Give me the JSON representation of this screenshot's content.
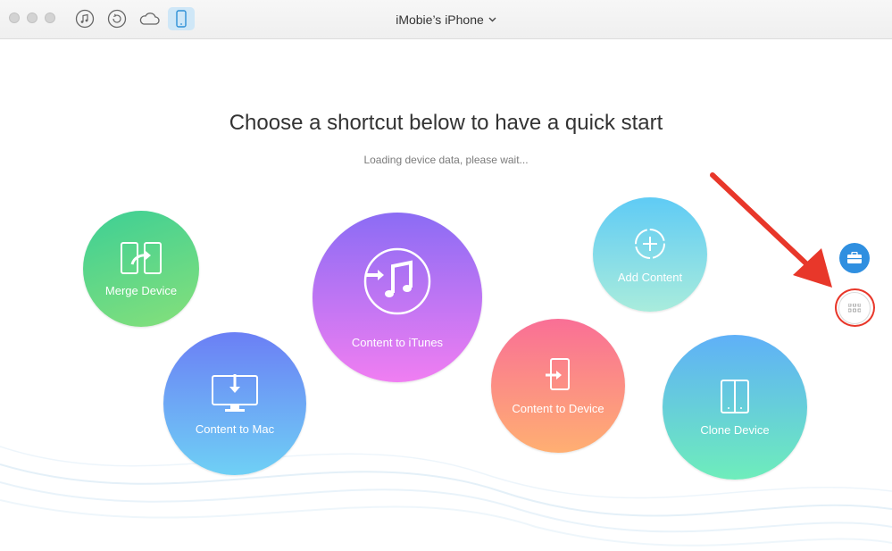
{
  "window": {
    "device_name": "iMobie’s iPhone",
    "toolbar_icons": [
      "itunes-icon",
      "backup-restore-icon",
      "icloud-icon",
      "iphone-icon"
    ]
  },
  "main": {
    "headline": "Choose a shortcut below to have a quick start",
    "status": "Loading device data, please wait..."
  },
  "shortcuts": {
    "merge_device": "Merge Device",
    "content_to_mac": "Content to Mac",
    "content_to_itunes": "Content to iTunes",
    "add_content": "Add Content",
    "content_to_device": "Content to Device",
    "clone_device": "Clone Device"
  },
  "colors": {
    "accent_blue": "#2f8fe0",
    "annotation_red": "#e8372a"
  }
}
